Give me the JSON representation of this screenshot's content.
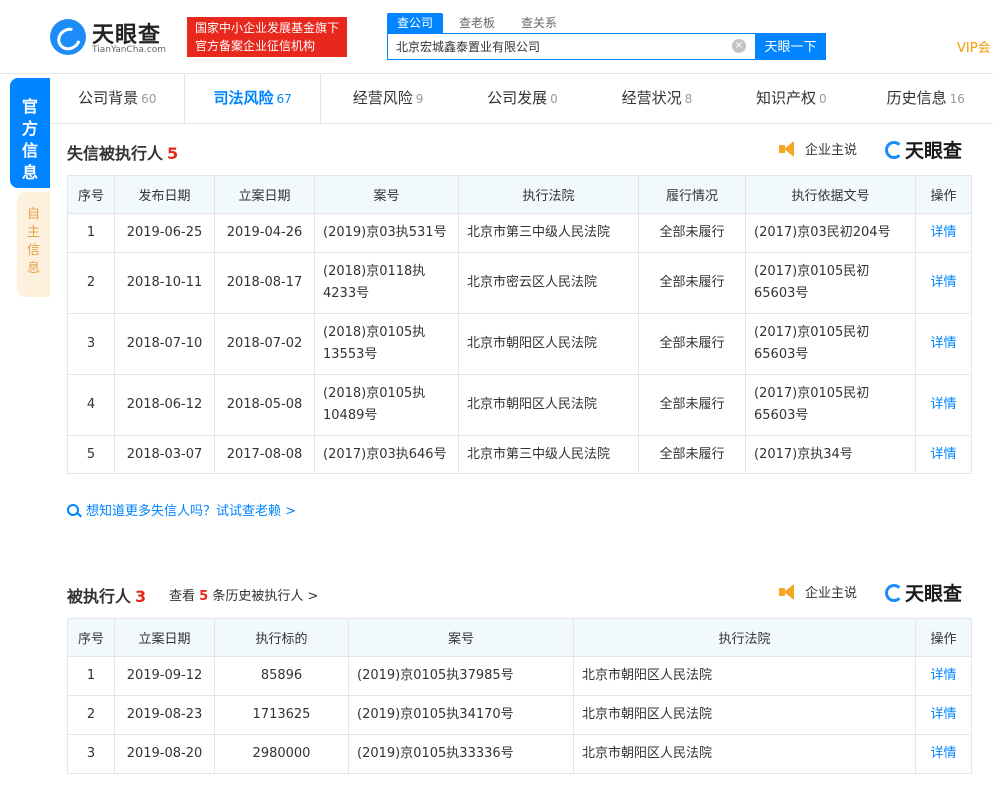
{
  "header": {
    "logo_text": "天眼查",
    "logo_sub": "TianYanCha.com",
    "badge_line1": "国家中小企业发展基金旗下",
    "badge_line2": "官方备案企业征信机构",
    "search_tabs": [
      "查公司",
      "查老板",
      "查关系"
    ],
    "search_value": "北京宏城鑫泰置业有限公司",
    "search_button": "天眼一下",
    "vip": "VIP会"
  },
  "side": {
    "official": "官方信息",
    "own": "自主信息"
  },
  "nav": [
    {
      "label": "公司背景",
      "count": "60"
    },
    {
      "label": "司法风险",
      "count": "67"
    },
    {
      "label": "经营风险",
      "count": "9"
    },
    {
      "label": "公司发展",
      "count": "0"
    },
    {
      "label": "经营状况",
      "count": "8"
    },
    {
      "label": "知识产权",
      "count": "0"
    },
    {
      "label": "历史信息",
      "count": "16"
    }
  ],
  "promo_label": "企业主说",
  "brand_label": "天眼查",
  "section1": {
    "title": "失信被执行人",
    "count": "5",
    "headers": [
      "序号",
      "发布日期",
      "立案日期",
      "案号",
      "执行法院",
      "履行情况",
      "执行依据文号",
      "操作"
    ],
    "rows": [
      [
        "1",
        "2019-06-25",
        "2019-04-26",
        "(2019)京03执531号",
        "北京市第三中级人民法院",
        "全部未履行",
        "(2017)京03民初204号",
        "详情"
      ],
      [
        "2",
        "2018-10-11",
        "2018-08-17",
        "(2018)京0118执4233号",
        "北京市密云区人民法院",
        "全部未履行",
        "(2017)京0105民初65603号",
        "详情"
      ],
      [
        "3",
        "2018-07-10",
        "2018-07-02",
        "(2018)京0105执13553号",
        "北京市朝阳区人民法院",
        "全部未履行",
        "(2017)京0105民初65603号",
        "详情"
      ],
      [
        "4",
        "2018-06-12",
        "2018-05-08",
        "(2018)京0105执10489号",
        "北京市朝阳区人民法院",
        "全部未履行",
        "(2017)京0105民初65603号",
        "详情"
      ],
      [
        "5",
        "2018-03-07",
        "2017-08-08",
        "(2017)京03执646号",
        "北京市第三中级人民法院",
        "全部未履行",
        "(2017)京执34号",
        "详情"
      ]
    ],
    "more_link": "想知道更多失信人吗？试试查老赖 >"
  },
  "section2": {
    "title": "被执行人",
    "count": "3",
    "history_prefix": "查看",
    "history_count": "5",
    "history_suffix": "条历史被执行人 >",
    "headers": [
      "序号",
      "立案日期",
      "执行标的",
      "案号",
      "执行法院",
      "操作"
    ],
    "rows": [
      [
        "1",
        "2019-09-12",
        "85896",
        "(2019)京0105执37985号",
        "北京市朝阳区人民法院",
        "详情"
      ],
      [
        "2",
        "2019-08-23",
        "1713625",
        "(2019)京0105执34170号",
        "北京市朝阳区人民法院",
        "详情"
      ],
      [
        "3",
        "2019-08-20",
        "2980000",
        "(2019)京0105执33336号",
        "北京市朝阳区人民法院",
        "详情"
      ]
    ]
  }
}
